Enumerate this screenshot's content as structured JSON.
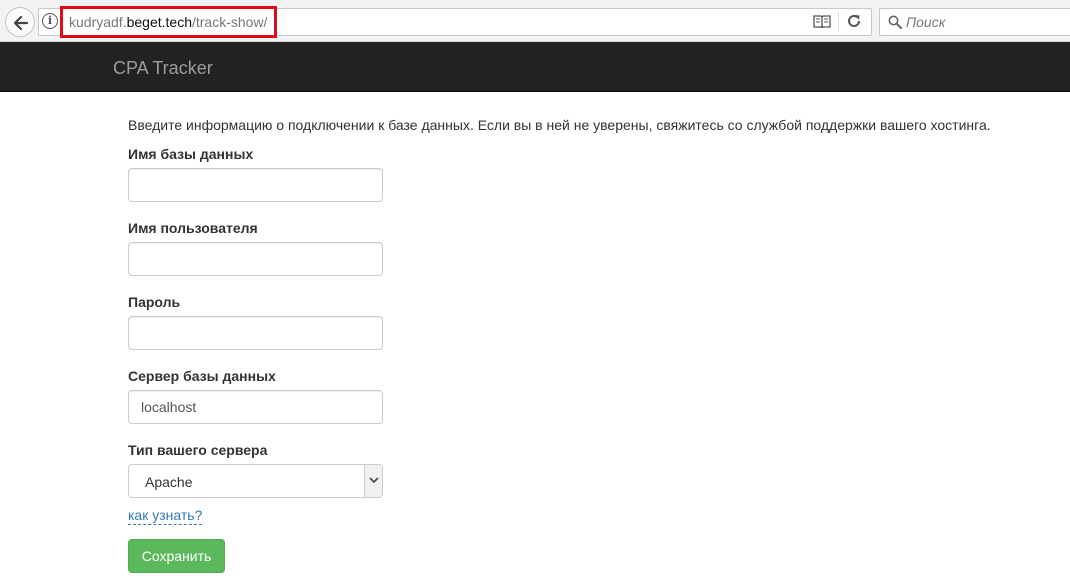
{
  "browser": {
    "url_prefix": "kudryadf.",
    "url_host": "beget.tech",
    "url_path": "/track-show/",
    "search_placeholder": "Поиск",
    "highlight_color": "#e00b14"
  },
  "navbar": {
    "brand": "CPA Tracker",
    "background": "#222222"
  },
  "form": {
    "intro": "Введите информацию о подключении к базе данных. Если вы в ней не уверены, свяжитесь со службой поддержки вашего хостинга.",
    "db_name_label": "Имя базы данных",
    "db_name_value": "",
    "user_label": "Имя пользователя",
    "user_value": "",
    "password_label": "Пароль",
    "password_value": "",
    "server_label": "Сервер базы данных",
    "server_value": "localhost",
    "server_type_label": "Тип вашего сервера",
    "server_type_value": "Apache",
    "help_link": "как узнать?",
    "save_label": "Сохранить",
    "save_color": "#5cb85c"
  }
}
